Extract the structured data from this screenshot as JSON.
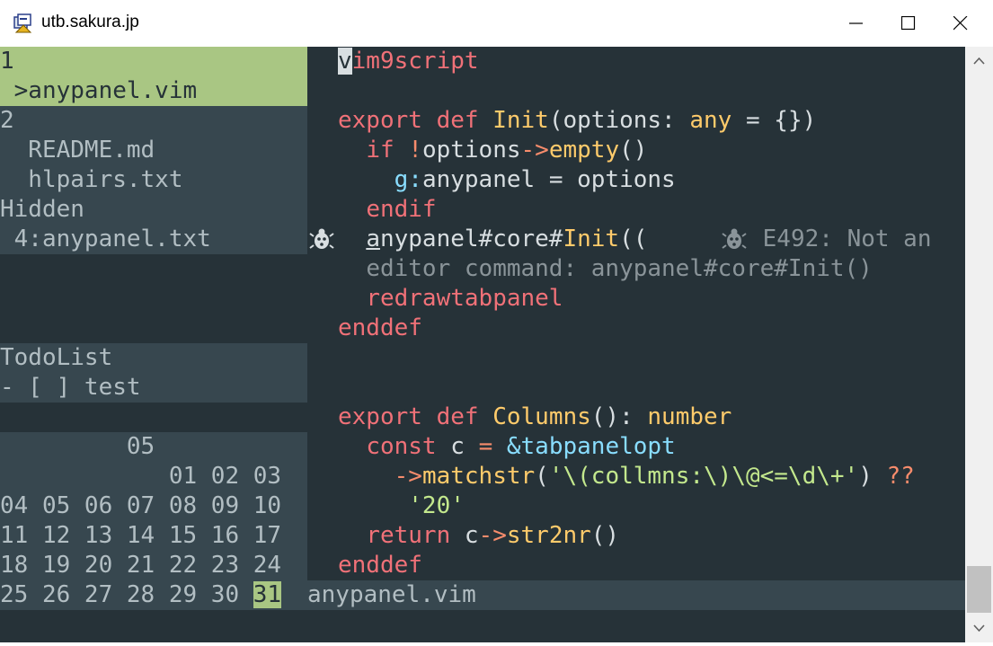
{
  "window": {
    "title": "utb.sakura.jp"
  },
  "icons": {
    "app": "app-icon",
    "minimize": "minimize-icon",
    "maximize": "maximize-icon",
    "close": "close-icon",
    "scroll_up": "chevron-up-icon",
    "scroll_down": "chevron-down-icon",
    "sign": "bug-sign-icon"
  },
  "colors": {
    "accent_green": "#a9c683",
    "bg": "#263238",
    "panel": "#37474f",
    "keyword": "#f07178",
    "function": "#ffcb6b",
    "string": "#c3e88d"
  },
  "tabpanel": {
    "tab1_num": "1",
    "tab1_file": " >anypanel.vim",
    "tab2_num": "2",
    "tab2_files": [
      "  README.md",
      "  hlpairs.txt"
    ],
    "hidden_label": "Hidden",
    "hidden_file": " 4:anypanel.txt",
    "todo_title": "TodoList",
    "todo_item": "- [ ] test",
    "calendar": {
      "month": "05",
      "rows": [
        "            01 02 03",
        "04 05 06 07 08 09 10",
        "11 12 13 14 15 16 17",
        "18 19 20 21 22 23 24",
        "25 26 27 28 29 30 "
      ],
      "today": "31"
    }
  },
  "editor": {
    "cursor_char": "v",
    "l1_rest": "im9script",
    "l3": {
      "kw1": "export",
      "kw2": "def",
      "fn": "Init",
      "p1": "(options: ",
      "ty": "any",
      "p2": " = {})"
    },
    "l4": {
      "kw": "if",
      "op": "!",
      "p1": "options",
      "arrow": "->",
      "fn": "empty",
      "p2": "()"
    },
    "l5": {
      "ns": "g:",
      "p1": "anypanel = options"
    },
    "l6": {
      "kw": "endif"
    },
    "l7": {
      "cursor_char": "a",
      "p1": "nypanel#core#",
      "fn": "Init",
      "p2": "((",
      "err": " E492: Not an"
    },
    "l8": {
      "err": "editor command: anypanel#core#Init()"
    },
    "l9": {
      "kw": "redrawtabpanel"
    },
    "l10": {
      "kw": "enddef"
    },
    "l13": {
      "kw1": "export",
      "kw2": "def",
      "fn": "Columns",
      "p1": "(): ",
      "ty": "number"
    },
    "l14": {
      "kw": "const",
      "p1": " c ",
      "op": "=",
      "ns": " &tabpanelopt"
    },
    "l15": {
      "arrow": "->",
      "fn": "matchstr",
      "p1": "(",
      "str": "'\\(collmns:\\)\\@<=\\d\\+'",
      "p2": ") ",
      "op": "??"
    },
    "l16": {
      "str": "'20'"
    },
    "l17": {
      "kw": "return",
      "p1": " c",
      "arrow": "->",
      "fn": "str2nr",
      "p2": "()"
    },
    "l18": {
      "kw": "enddef"
    }
  },
  "statusline": {
    "filename": "anypanel.vim"
  }
}
